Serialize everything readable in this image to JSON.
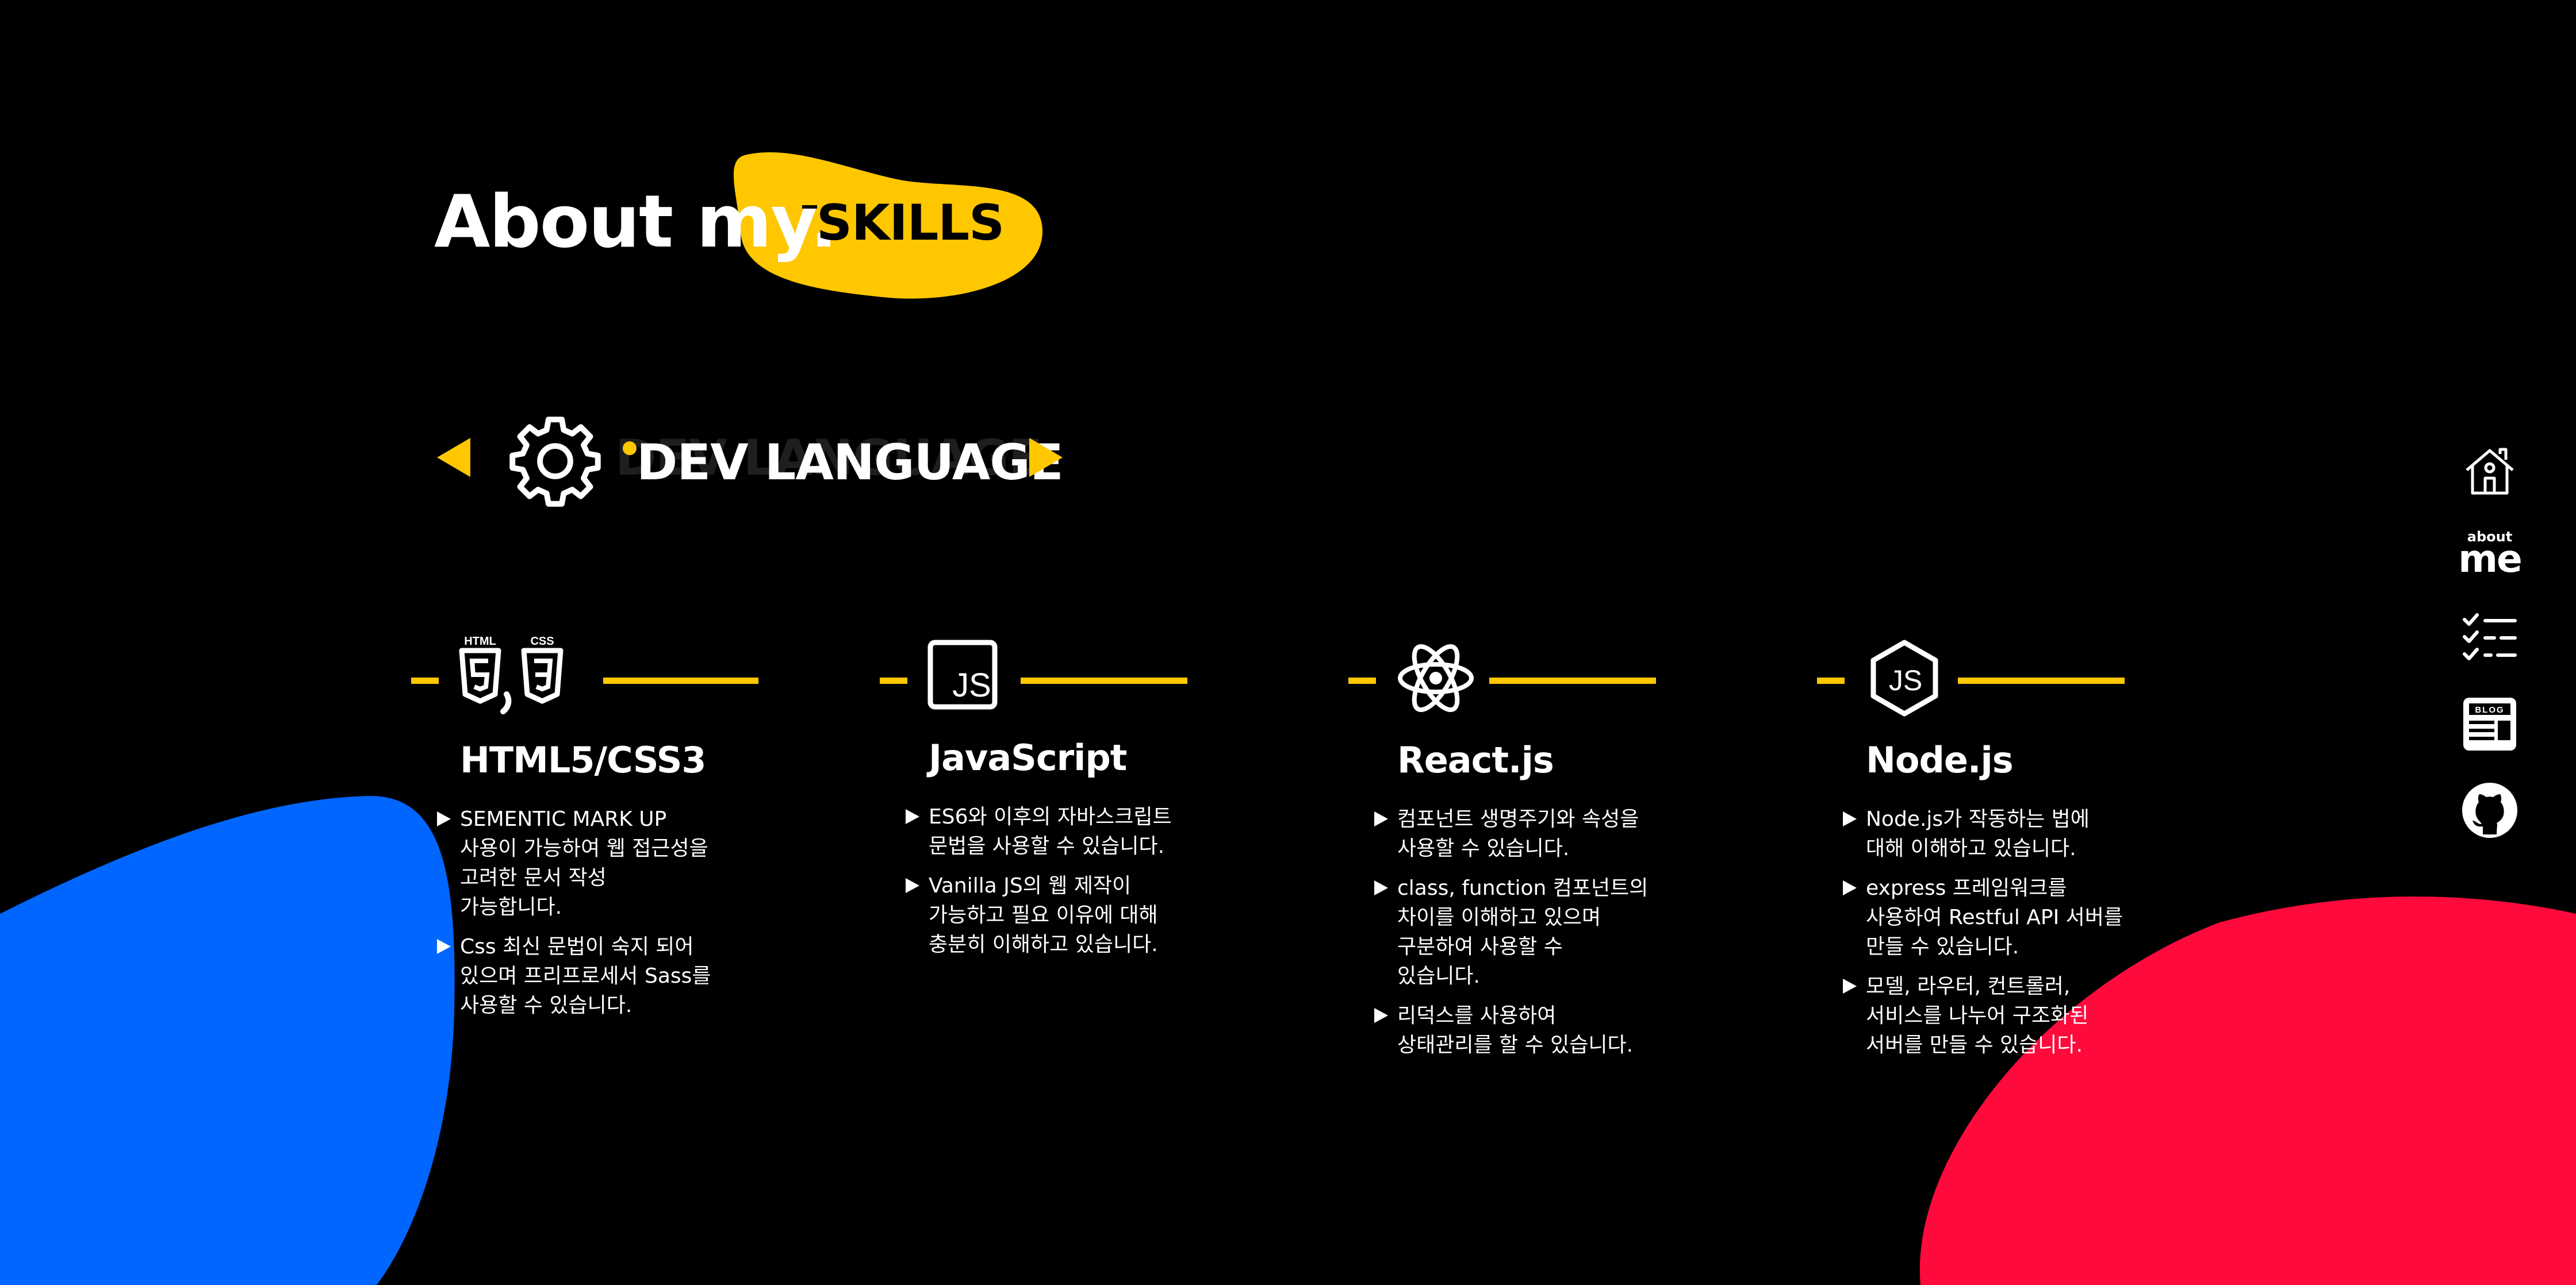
{
  "title": {
    "main": "About my.",
    "accent": "SKILLS"
  },
  "category": {
    "ghost": "DEV LANGUAGE",
    "label": "DEV LANGUAGE",
    "icon": "gear-icon"
  },
  "skills": [
    {
      "name": "HTML5/CSS3",
      "icon": "html5-css3-icon",
      "icon_labels": [
        "HTML",
        "CSS"
      ],
      "items": [
        "SEMENTIC MARK UP\n사용이 가능하여 웹 접근성을\n고려한 문서 작성\n가능합니다.",
        "Css 최신 문법이 숙지 되어\n있으며 프리프로세서 Sass를\n사용할 수 있습니다."
      ]
    },
    {
      "name": "JavaScript",
      "icon": "javascript-icon",
      "icon_labels": [
        "JS"
      ],
      "items": [
        "ES6와 이후의 자바스크립트\n문법을 사용할 수 있습니다.",
        "Vanilla JS의 웹 제작이\n가능하고 필요 이유에 대해\n충분히 이해하고 있습니다."
      ]
    },
    {
      "name": "React.js",
      "icon": "react-icon",
      "icon_labels": [],
      "items": [
        "컴포넌트 생명주기와 속성을\n사용할 수 있습니다.",
        "class, function 컴포넌트의\n차이를 이해하고 있으며\n구분하여 사용할 수\n있습니다.",
        "리덕스를 사용하여\n상태관리를 할 수 있습니다."
      ]
    },
    {
      "name": "Node.js",
      "icon": "nodejs-icon",
      "icon_labels": [
        "JS"
      ],
      "items": [
        "Node.js가 작동하는 법에\n대해 이해하고 있습니다.",
        "express 프레임워크를\n사용하여 Restful API 서버를\n만들 수 있습니다.",
        "모델, 라우터, 컨트롤러,\n서비스를 나누어 구조화된\n서버를 만들 수 있습니다."
      ]
    }
  ],
  "nav": {
    "items": [
      {
        "icon": "home-icon"
      },
      {
        "icon": "about-me-icon",
        "small": "about",
        "big": "me"
      },
      {
        "icon": "checklist-icon"
      },
      {
        "icon": "blog-icon",
        "label": "BLOG"
      },
      {
        "icon": "github-icon"
      }
    ]
  },
  "colors": {
    "background": "#000000",
    "accent_yellow": "#ffc700",
    "blob_blue": "#0066ff",
    "blob_red": "#ff0a3c",
    "text": "#ffffff"
  }
}
